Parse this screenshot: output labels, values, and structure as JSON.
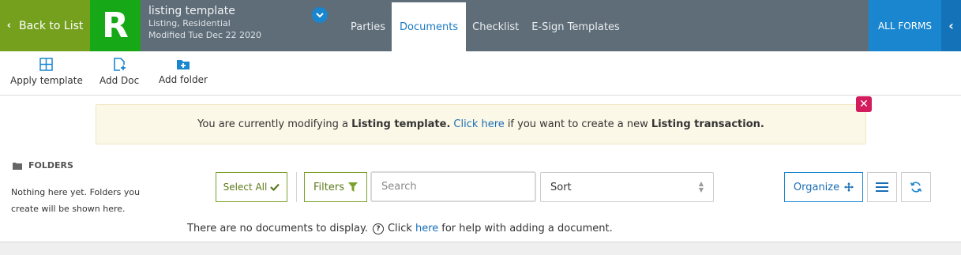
{
  "header": {
    "back_label": "Back to List",
    "logo_letter": "R",
    "template_title": "listing template",
    "template_type": "Listing, Residential",
    "modified": "Modified Tue Dec 22 2020",
    "tabs": [
      {
        "label": "Parties",
        "active": false
      },
      {
        "label": "Documents",
        "active": true
      },
      {
        "label": "Checklist",
        "active": false
      },
      {
        "label": "E-Sign Templates",
        "active": false
      }
    ],
    "all_forms_label": "ALL FORMS"
  },
  "toolbar": {
    "apply_template_label": "Apply template",
    "add_doc_label": "Add Doc",
    "add_folder_label": "Add folder"
  },
  "banner": {
    "text_before": "You are currently modifying a",
    "bold_1": "Listing template.",
    "link": "Click here",
    "text_middle": "if you want to create a new",
    "bold_2": "Listing transaction."
  },
  "folders": {
    "heading": "FOLDERS",
    "empty_text": "Nothing here yet. Folders you create will be shown here."
  },
  "controls": {
    "select_all_label": "Select All",
    "filters_label": "Filters",
    "search_placeholder": "Search",
    "sort_label": "Sort",
    "organize_label": "Organize"
  },
  "empty_documents": {
    "text_before": "There are no documents to display.",
    "click": "Click",
    "link": "here",
    "text_after": "for help with adding a document."
  },
  "colors": {
    "back_green": "#74a01e",
    "logo_green": "#17a817",
    "header_gray": "#5f6d78",
    "accent_blue": "#1a86d0",
    "close_red": "#d31c5c",
    "banner_bg": "#fcf8e7"
  }
}
